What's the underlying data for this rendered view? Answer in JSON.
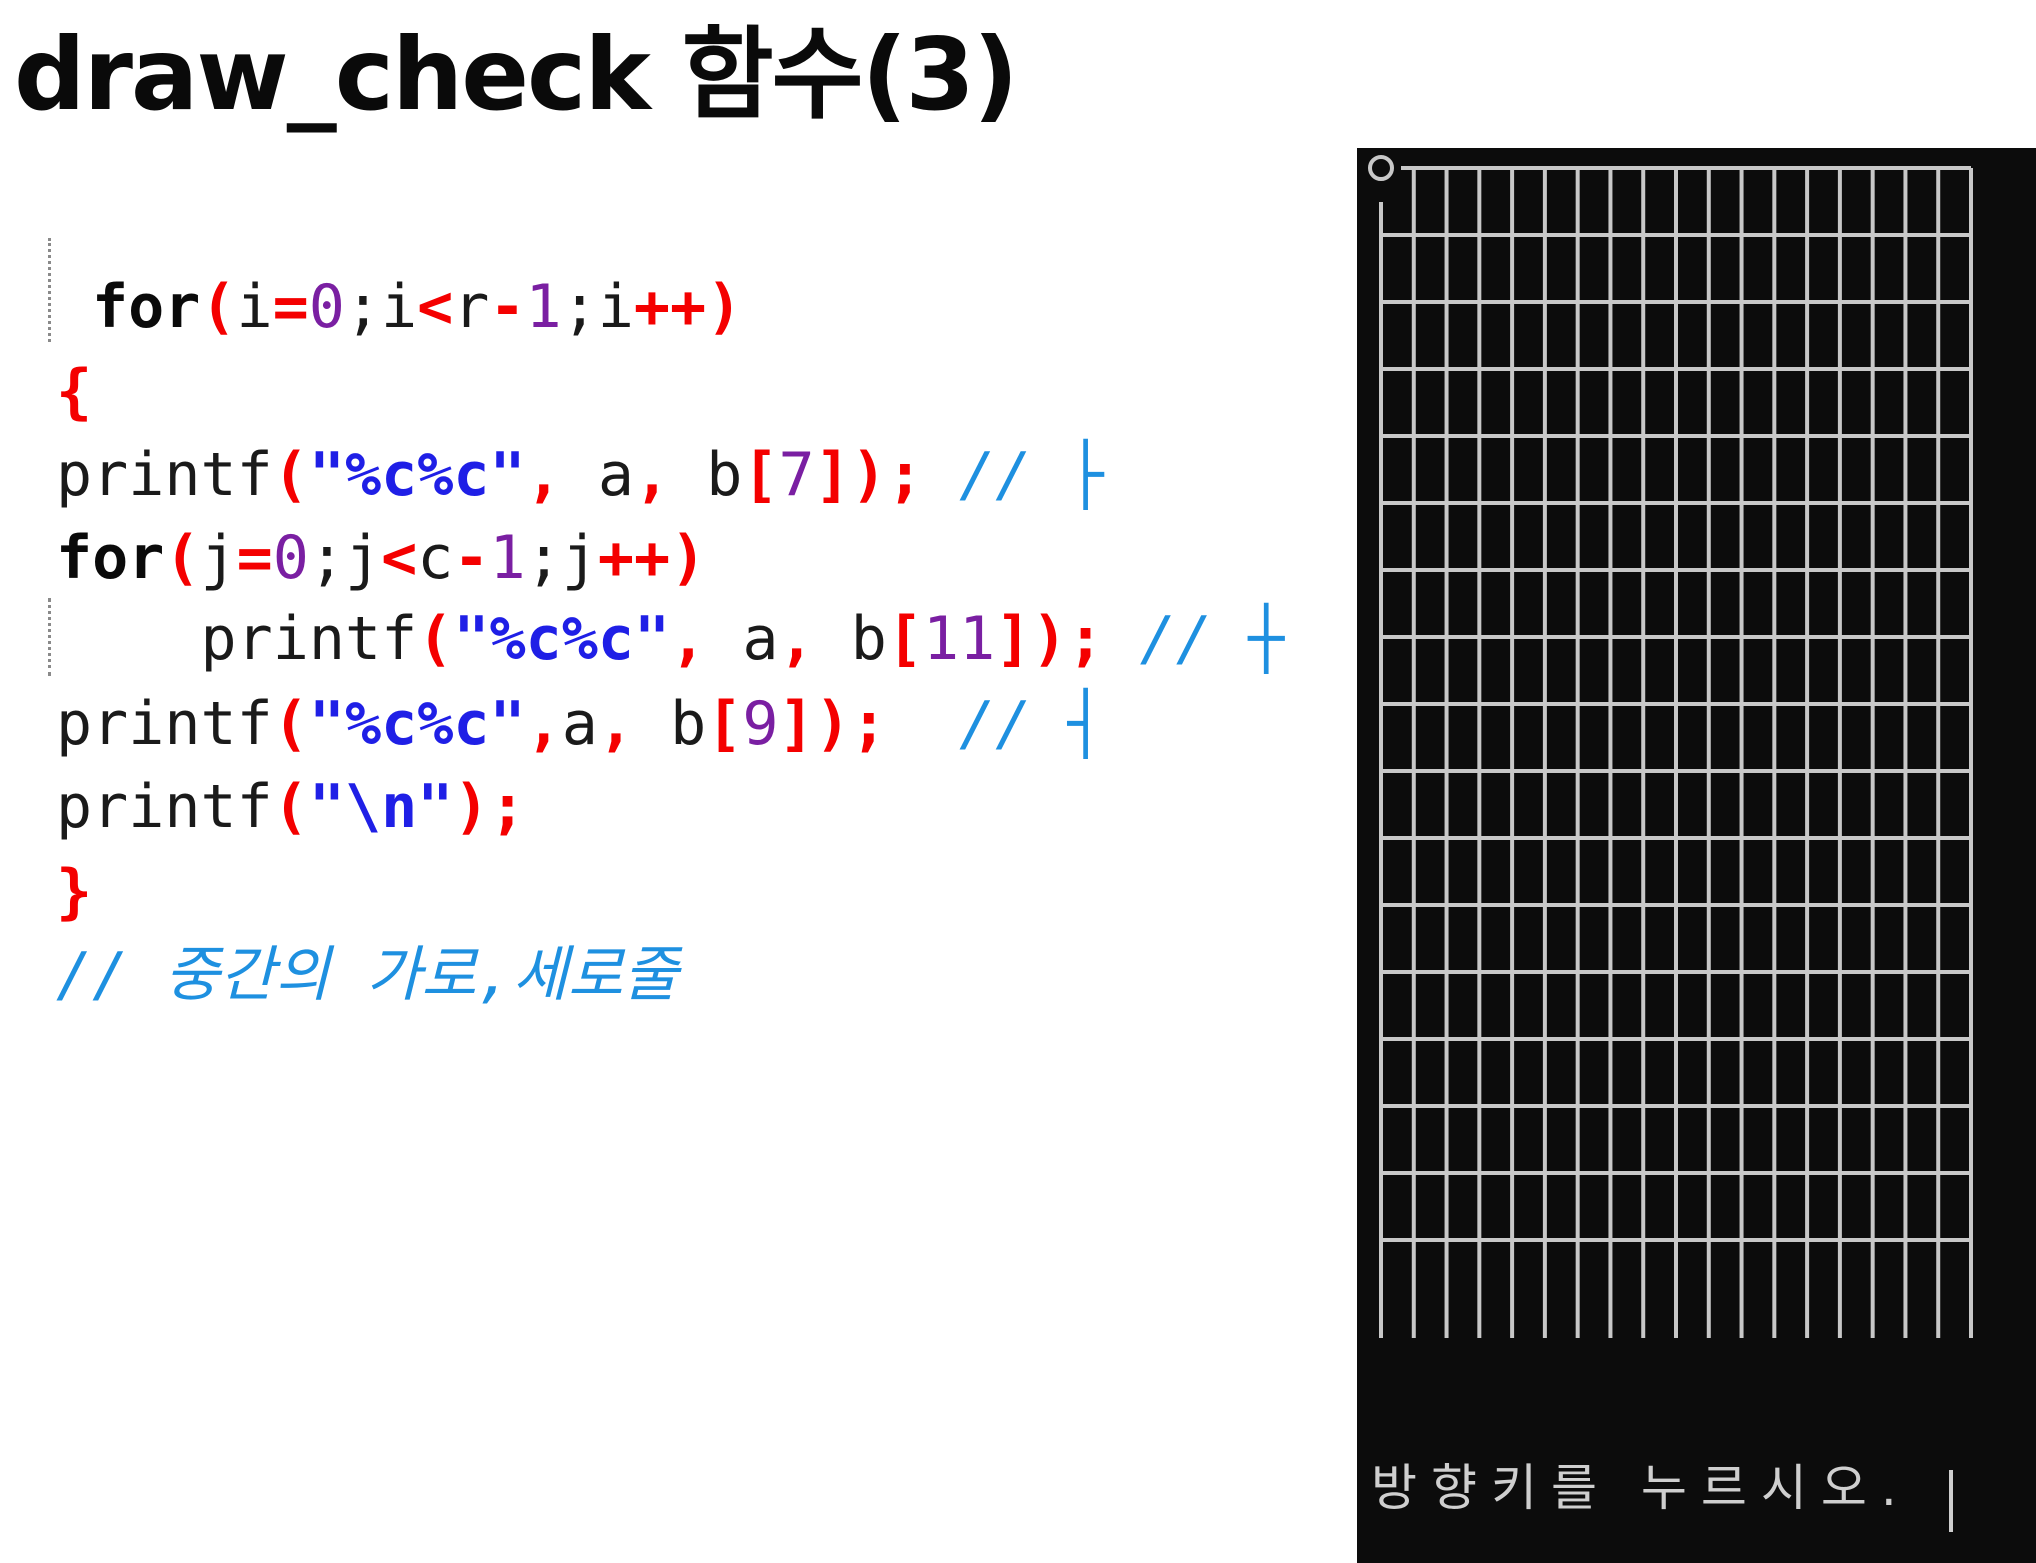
{
  "slide": {
    "title": "draw_check 함수(3)"
  },
  "code": {
    "lines": [
      [
        {
          "t": "kw",
          "v": "for"
        },
        {
          "t": "op",
          "v": "("
        },
        {
          "t": "id",
          "v": "i"
        },
        {
          "t": "op",
          "v": "="
        },
        {
          "t": "num",
          "v": "0"
        },
        {
          "t": "id",
          "v": ";i"
        },
        {
          "t": "op",
          "v": "<"
        },
        {
          "t": "id",
          "v": "r"
        },
        {
          "t": "op",
          "v": "-"
        },
        {
          "t": "num",
          "v": "1"
        },
        {
          "t": "id",
          "v": ";i"
        },
        {
          "t": "op",
          "v": "++)"
        }
      ],
      [
        {
          "t": "brace",
          "v": "{"
        }
      ],
      [
        {
          "t": "id",
          "v": "printf"
        },
        {
          "t": "op",
          "v": "("
        },
        {
          "t": "str",
          "v": "\"%c%c\""
        },
        {
          "t": "op",
          "v": ", "
        },
        {
          "t": "id",
          "v": "a"
        },
        {
          "t": "op",
          "v": ", "
        },
        {
          "t": "id",
          "v": "b"
        },
        {
          "t": "op",
          "v": "["
        },
        {
          "t": "num",
          "v": "7"
        },
        {
          "t": "op",
          "v": "]);"
        },
        {
          "t": "cmt",
          "v": " // ├"
        }
      ],
      [
        {
          "t": "kw",
          "v": "for"
        },
        {
          "t": "op",
          "v": "("
        },
        {
          "t": "id",
          "v": "j"
        },
        {
          "t": "op",
          "v": "="
        },
        {
          "t": "num",
          "v": "0"
        },
        {
          "t": "id",
          "v": ";j"
        },
        {
          "t": "op",
          "v": "<"
        },
        {
          "t": "id",
          "v": "c"
        },
        {
          "t": "op",
          "v": "-"
        },
        {
          "t": "num",
          "v": "1"
        },
        {
          "t": "id",
          "v": ";j"
        },
        {
          "t": "op",
          "v": "++)"
        }
      ],
      [
        {
          "t": "id",
          "v": "    printf"
        },
        {
          "t": "op",
          "v": "("
        },
        {
          "t": "str",
          "v": "\"%c%c\""
        },
        {
          "t": "op",
          "v": ", "
        },
        {
          "t": "id",
          "v": "a"
        },
        {
          "t": "op",
          "v": ", "
        },
        {
          "t": "id",
          "v": "b"
        },
        {
          "t": "op",
          "v": "["
        },
        {
          "t": "num",
          "v": "11"
        },
        {
          "t": "op",
          "v": "]);"
        },
        {
          "t": "cmt",
          "v": " // ┼"
        }
      ],
      [
        {
          "t": "id",
          "v": "printf"
        },
        {
          "t": "op",
          "v": "("
        },
        {
          "t": "str",
          "v": "\"%c%c\""
        },
        {
          "t": "op",
          "v": ","
        },
        {
          "t": "id",
          "v": "a"
        },
        {
          "t": "op",
          "v": ", "
        },
        {
          "t": "id",
          "v": "b"
        },
        {
          "t": "op",
          "v": "["
        },
        {
          "t": "num",
          "v": "9"
        },
        {
          "t": "op",
          "v": "]);"
        },
        {
          "t": "cmt",
          "v": "  // ┤"
        }
      ],
      [
        {
          "t": "id",
          "v": "printf"
        },
        {
          "t": "op",
          "v": "("
        },
        {
          "t": "str",
          "v": "\"\\n\""
        },
        {
          "t": "op",
          "v": ");"
        }
      ],
      [
        {
          "t": "brace",
          "v": "}"
        }
      ],
      [
        {
          "t": "cmt",
          "v": "// 중간의 가로,세로줄"
        }
      ]
    ]
  },
  "console": {
    "prompt_text": "방향키를 누르시오.",
    "grid": {
      "columns": 18,
      "rows": 17,
      "marker": "○"
    },
    "colors": {
      "background": "#0c0c0c",
      "lines": "#c8c8c8",
      "text": "#cfcfcf"
    }
  }
}
